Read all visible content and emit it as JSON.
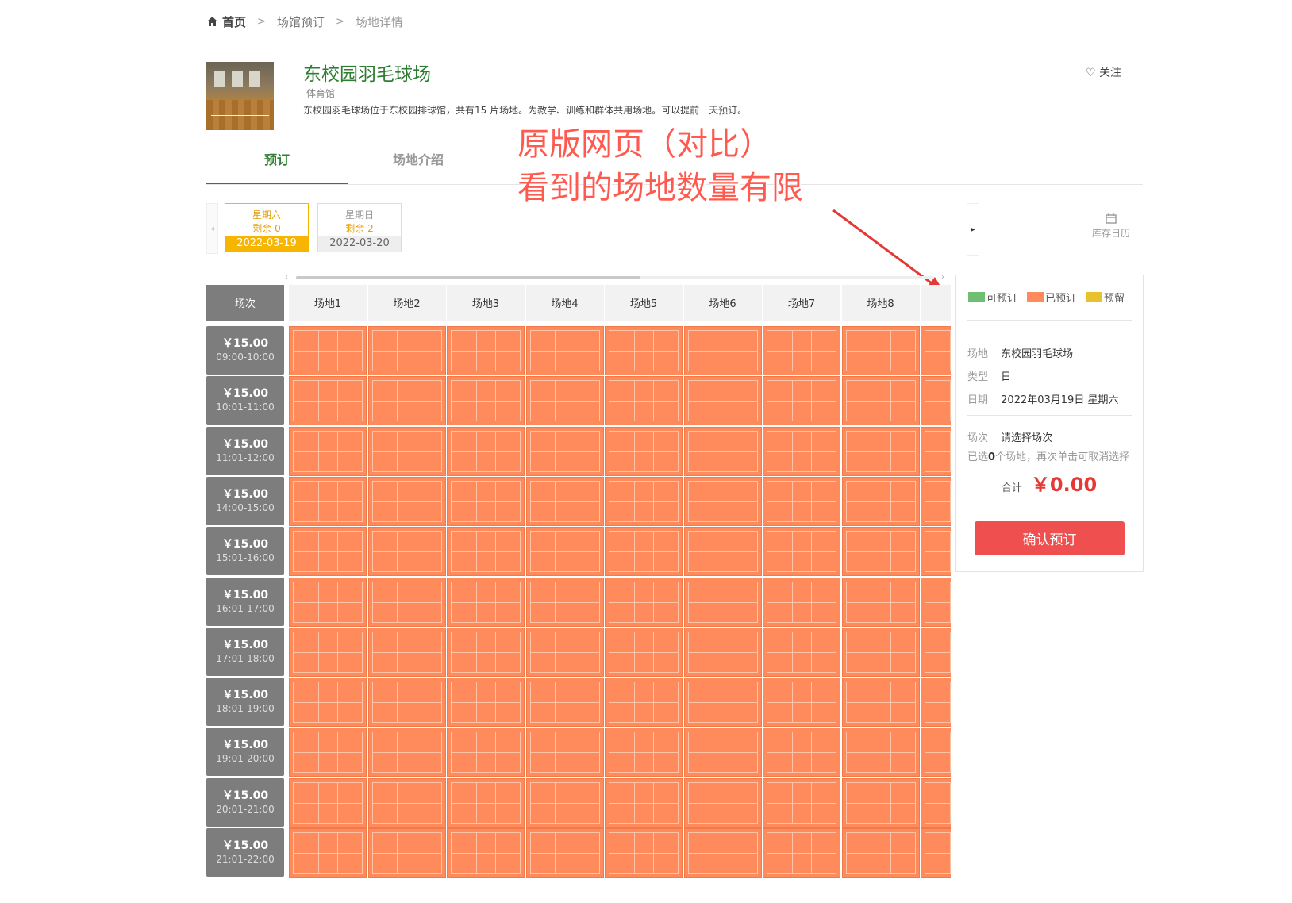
{
  "breadcrumb": {
    "home": "首页",
    "items": [
      "场馆预订",
      "场地详情"
    ]
  },
  "venue": {
    "title": "东校园羽毛球场",
    "type": "体育馆",
    "description": "东校园羽毛球场位于东校园排球馆，共有15 片场地。为教学、训练和群体共用场地。可以提前一天预订。",
    "follow_label": "关注"
  },
  "tabs": [
    {
      "label": "预订",
      "active": true
    },
    {
      "label": "场地介绍",
      "active": false
    }
  ],
  "annotation": {
    "line1": "原版网页（对比）",
    "line2": "看到的场地数量有限"
  },
  "dates": [
    {
      "weekday": "星期六",
      "remaining": "剩余 0",
      "date": "2022-03-19",
      "active": true
    },
    {
      "weekday": "星期日",
      "remaining": "剩余 2",
      "date": "2022-03-20",
      "active": false
    }
  ],
  "calendar_label": "库存日历",
  "grid": {
    "corner_label": "场次",
    "courts": [
      "场地1",
      "场地2",
      "场地3",
      "场地4",
      "场地5",
      "场地6",
      "场地7",
      "场地8"
    ],
    "slots": [
      {
        "price": "￥15.00",
        "time": "09:00-10:00"
      },
      {
        "price": "￥15.00",
        "time": "10:01-11:00"
      },
      {
        "price": "￥15.00",
        "time": "11:01-12:00"
      },
      {
        "price": "￥15.00",
        "time": "14:00-15:00"
      },
      {
        "price": "￥15.00",
        "time": "15:01-16:00"
      },
      {
        "price": "￥15.00",
        "time": "16:01-17:00"
      },
      {
        "price": "￥15.00",
        "time": "17:01-18:00"
      },
      {
        "price": "￥15.00",
        "time": "18:01-19:00"
      },
      {
        "price": "￥15.00",
        "time": "19:01-20:00"
      },
      {
        "price": "￥15.00",
        "time": "20:01-21:00"
      },
      {
        "price": "￥15.00",
        "time": "21:01-22:00"
      }
    ],
    "cell_status": "booked"
  },
  "colors": {
    "available": "#6fbf73",
    "booked": "#ff8a5b",
    "reserved": "#e8c12f",
    "accent": "#2e7d32",
    "confirm": "#ef4f4f"
  },
  "panel": {
    "legend": [
      {
        "label": "可预订",
        "color": "#6fbf73"
      },
      {
        "label": "已预订",
        "color": "#ff8a5b"
      },
      {
        "label": "预留",
        "color": "#e8c12f"
      }
    ],
    "venue_key": "场地",
    "venue_value": "东校园羽毛球场",
    "type_key": "类型",
    "type_value": "日",
    "date_key": "日期",
    "date_value": "2022年03月19日 星期六",
    "slot_key": "场次",
    "slot_value": "请选择场次",
    "hint_prefix": "已选",
    "hint_count": "0",
    "hint_suffix": "个场地，再次单击可取消选择",
    "total_key": "合计",
    "total_value": "￥0.00",
    "confirm_label": "确认预订"
  }
}
